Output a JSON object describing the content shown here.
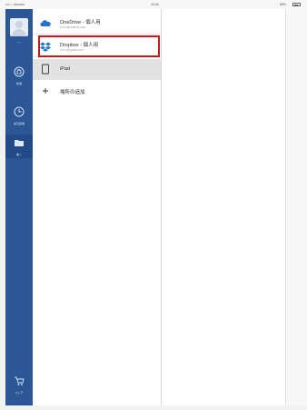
{
  "statusbar": {
    "carrier": "•••○○ docomo",
    "time": "15:36",
    "battery": "85%"
  },
  "nav": {
    "account_label": "——",
    "items": [
      {
        "label": "新規",
        "icon": "new-document-icon"
      },
      {
        "label": "最近使用",
        "icon": "recent-clock-icon"
      },
      {
        "label": "開く",
        "icon": "folder-open-icon",
        "active": true
      }
    ],
    "store_label": "ストア",
    "store_icon": "cart-icon"
  },
  "locations": [
    {
      "title": "OneDrive - 個人用",
      "subtitle": "•••••••@outlook.com",
      "icon": "onedrive-cloud-icon"
    },
    {
      "title": "Dropbox - 個人用",
      "subtitle": "•••••••@gmail.com",
      "icon": "dropbox-icon",
      "highlighted": true
    },
    {
      "title": "iPad",
      "subtitle": "",
      "icon": "ipad-device-icon",
      "selected": true
    },
    {
      "title": "場所の追加",
      "subtitle": "",
      "icon": "plus-icon"
    }
  ],
  "colors": {
    "nav_background": "#2b5797",
    "highlight": "#c11a1a",
    "onedrive": "#2a6fc9",
    "dropbox": "#1f77d1"
  }
}
